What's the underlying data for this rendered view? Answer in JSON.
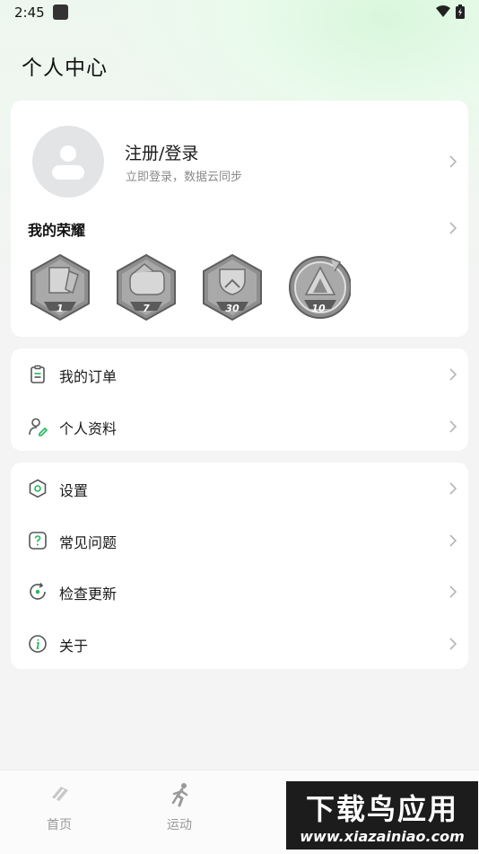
{
  "status_bar": {
    "time": "2:45"
  },
  "page": {
    "title": "个人中心"
  },
  "profile": {
    "title": "注册/登录",
    "subtitle": "立即登录，数据云同步"
  },
  "honors": {
    "title": "我的荣耀",
    "badges": [
      {
        "label": "1"
      },
      {
        "label": "7"
      },
      {
        "label": "30"
      },
      {
        "label": "10"
      }
    ]
  },
  "menu_group_1": [
    {
      "label": "我的订单",
      "icon": "clipboard-icon"
    },
    {
      "label": "个人资料",
      "icon": "user-edit-icon"
    }
  ],
  "menu_group_2": [
    {
      "label": "设置",
      "icon": "settings-icon"
    },
    {
      "label": "常见问题",
      "icon": "question-icon"
    },
    {
      "label": "检查更新",
      "icon": "update-icon"
    },
    {
      "label": "关于",
      "icon": "info-icon"
    }
  ],
  "bottom_nav": [
    {
      "label": "首页",
      "icon": "home-icon"
    },
    {
      "label": "运动",
      "icon": "running-icon"
    },
    {
      "label": "",
      "icon": "record-icon"
    },
    {
      "label": "",
      "icon": "profile-icon"
    }
  ],
  "watermark": {
    "top": "下载鸟应用",
    "bottom": "www.xiazainiao.com"
  },
  "colors": {
    "accent": "#1fb85a",
    "icon_gray": "#555555"
  }
}
